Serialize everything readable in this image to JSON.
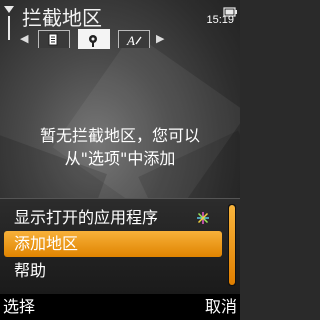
{
  "header": {
    "title": "拦截地区",
    "time": "15:19"
  },
  "tabs": [
    {
      "icon": "document-icon",
      "active": false
    },
    {
      "icon": "settings-icon",
      "active": true
    },
    {
      "icon": "text-style-icon",
      "active": false
    }
  ],
  "main": {
    "empty_line1": "暂无拦截地区，您可以",
    "empty_line2": "从\"选项\"中添加"
  },
  "menu": {
    "items": [
      {
        "label": "显示打开的应用程序",
        "icon": "sparkle-icon"
      },
      {
        "label": "添加地区",
        "selected": true
      },
      {
        "label": "帮助"
      }
    ]
  },
  "softkeys": {
    "left": "选择",
    "right": "取消"
  },
  "colors": {
    "accent": "#f0a020",
    "background": "#3c3c3c"
  }
}
